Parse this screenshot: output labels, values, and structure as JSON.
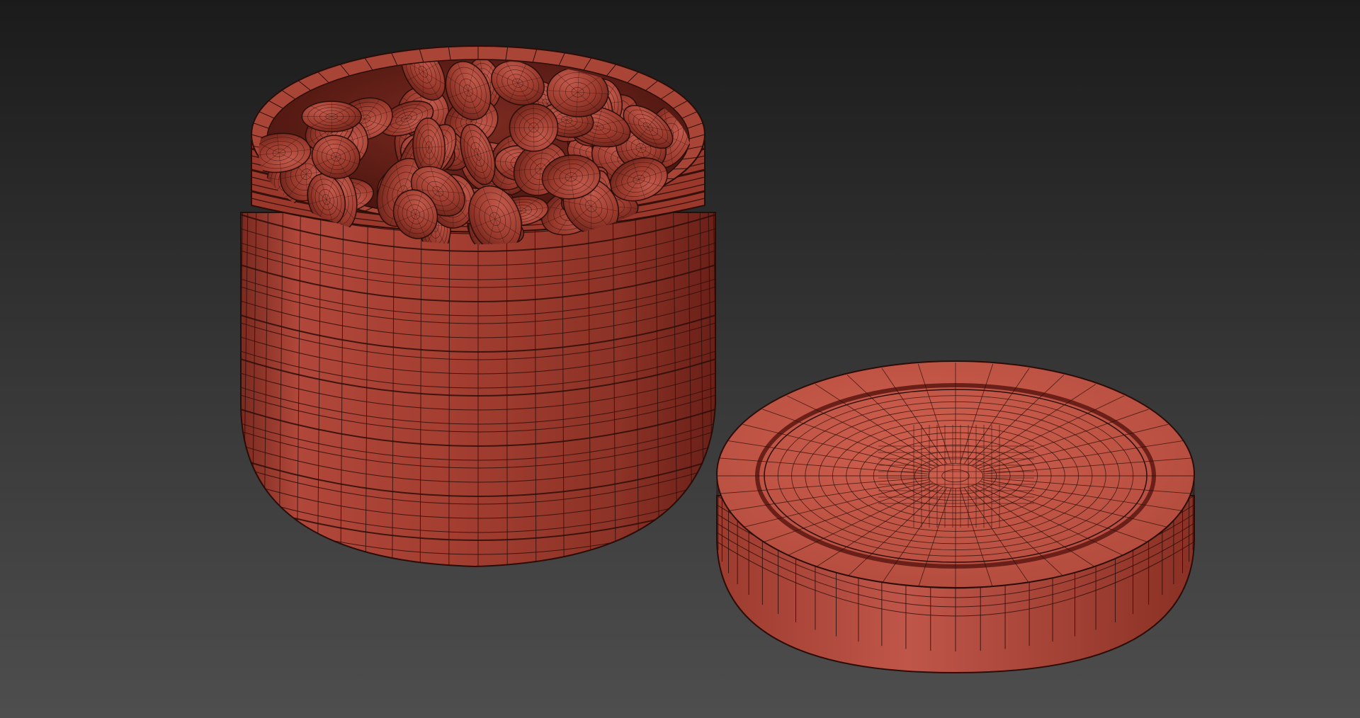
{
  "scene": {
    "background_top": "#1b1b1b",
    "background_bottom": "#4e4e4e",
    "mesh_color": "#9e3b2e",
    "mesh_highlight": "#c4584a",
    "mesh_shadow": "#6a2018",
    "wire_color": "#2b0d08",
    "objects": [
      "jar",
      "pills",
      "lid"
    ],
    "icons": {
      "jar": "jar-wireframe-mesh",
      "pills": "pill-wireframe-mesh",
      "lid": "lid-wireframe-mesh"
    }
  }
}
